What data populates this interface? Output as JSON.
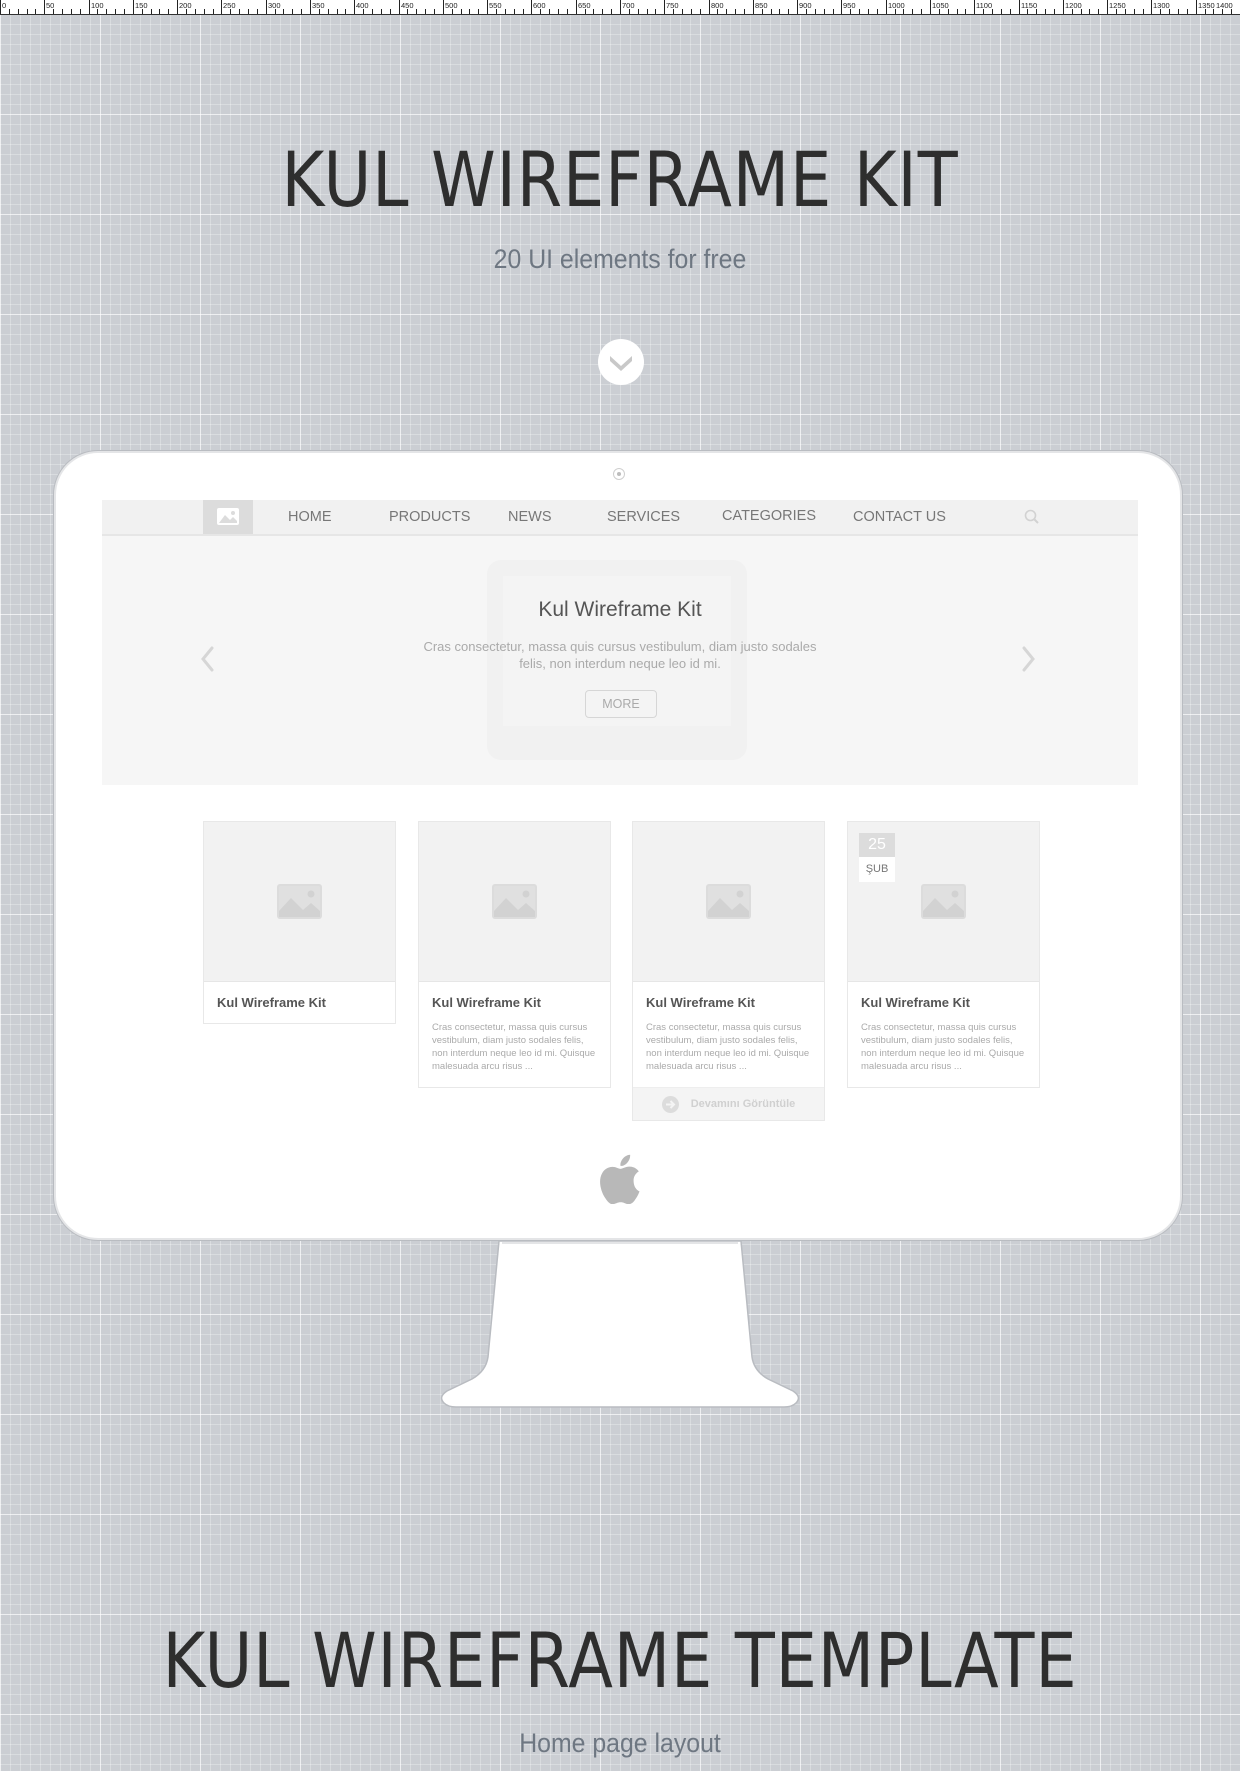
{
  "ruler": {
    "labels": [
      "0",
      "50",
      "100",
      "150",
      "200",
      "250",
      "300",
      "350",
      "400",
      "450",
      "500",
      "550",
      "600",
      "650",
      "700",
      "750",
      "800",
      "850",
      "900",
      "950",
      "1000",
      "1050",
      "1100",
      "1150",
      "1200",
      "1250",
      "1300",
      "1350",
      "1400"
    ]
  },
  "header": {
    "title": "KUL WIREFRAME KIT",
    "subtitle": "20 UI elements for free",
    "scroll_icon": "chevron-down-circle-icon"
  },
  "mockup": {
    "nav": {
      "logo_icon": "image-placeholder-icon",
      "items": [
        "HOME",
        "PRODUCTS",
        "NEWS",
        "SERVICES",
        "CATEGORIES",
        "CONTACT US"
      ],
      "search_icon": "search-icon"
    },
    "hero": {
      "title": "Kul  Wireframe Kit",
      "text": "Cras consectetur, massa quis cursus vestibulum, diam justo sodales felis, non interdum neque leo id mi.",
      "button": "MORE",
      "prev_icon": "chevron-left-icon",
      "next_icon": "chevron-right-icon"
    },
    "cards": [
      {
        "title": "Kul Wireframe Kit"
      },
      {
        "title": "Kul Wireframe Kit",
        "text": "Cras consectetur, massa quis cursus vestibulum, diam justo sodales felis, non interdum neque leo id mi. Quisque malesuada arcu risus ..."
      },
      {
        "title": "Kul Wireframe Kit",
        "text": "Cras consectetur, massa quis cursus vestibulum, diam justo sodales felis, non interdum neque leo id mi. Quisque malesuada arcu risus ...",
        "more": "Devamını Görüntüle"
      },
      {
        "title": "Kul Wireframe Kit",
        "text": "Cras consectetur, massa quis cursus vestibulum, diam justo sodales felis, non interdum neque leo id mi. Quisque malesuada arcu risus ...",
        "date_day": "25",
        "date_month": "ŞUB"
      }
    ],
    "brand_icon": "apple-logo-icon"
  },
  "footer": {
    "title": "KUL WIREFRAME TEMPLATE",
    "subtitle": "Home page layout"
  },
  "colors": {
    "background": "#cbced3",
    "heading": "#2e2e2e",
    "subheading": "#6e7782",
    "placeholder": "#dcdcdc"
  }
}
